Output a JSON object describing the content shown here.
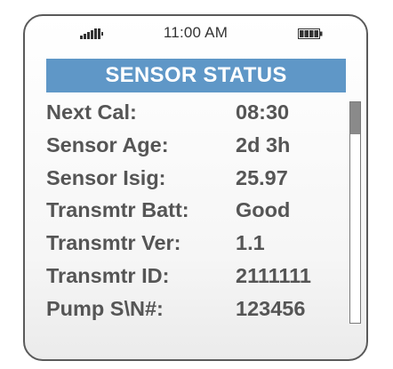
{
  "status_bar": {
    "time": "11:00 AM",
    "signal_icon": "signal-strength-icon",
    "battery_icon": "battery-full-icon"
  },
  "screen": {
    "title": "SENSOR STATUS",
    "title_bar_color": "#5f97c7",
    "rows": [
      {
        "label": "Next Cal:",
        "value": "08:30"
      },
      {
        "label": "Sensor Age:",
        "value": "2d 3h"
      },
      {
        "label": "Sensor Isig:",
        "value": "25.97"
      },
      {
        "label": "Transmtr Batt:",
        "value": "Good"
      },
      {
        "label": "Transmtr Ver:",
        "value": "1.1"
      },
      {
        "label": "Transmtr ID:",
        "value": "2111111"
      },
      {
        "label": "Pump S\\N#:",
        "value": "123456"
      }
    ]
  },
  "scrollbar": {
    "position_fraction": 0.0
  }
}
